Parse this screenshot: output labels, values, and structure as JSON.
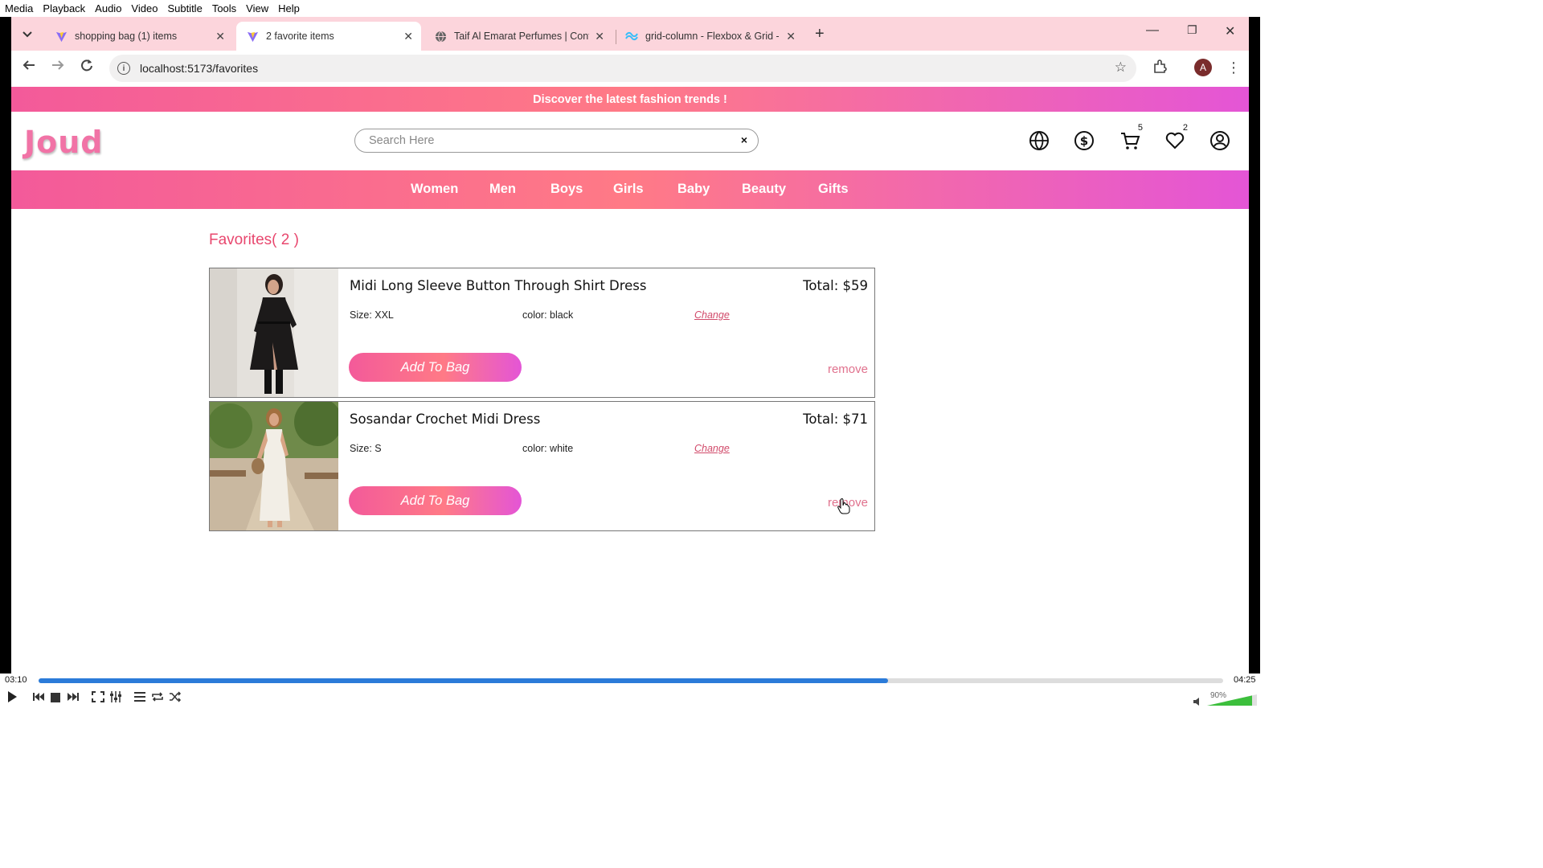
{
  "vlc": {
    "menu": [
      "Media",
      "Playback",
      "Audio",
      "Video",
      "Subtitle",
      "Tools",
      "View",
      "Help"
    ],
    "time_current": "03:10",
    "time_total": "04:25",
    "progress_fraction": 0.717,
    "volume": "90%"
  },
  "browser": {
    "tabs": [
      {
        "title": "shopping bag (1) items",
        "active": false
      },
      {
        "title": "2 favorite items",
        "active": true
      },
      {
        "title": "Taif Al Emarat Perfumes | Contir",
        "active": false
      },
      {
        "title": "grid-column - Flexbox & Grid -",
        "active": false
      }
    ],
    "url": "localhost:5173/favorites",
    "profile_initial": "A"
  },
  "site": {
    "promo": "Discover the latest fashion trends !",
    "logo": "Joud",
    "search_placeholder": "Search Here",
    "search_clear": "×",
    "cart_count": "5",
    "favorites_count": "2",
    "categories": [
      "Women",
      "Men",
      "Boys",
      "Girls",
      "Baby",
      "Beauty",
      "Gifts"
    ],
    "favorites_title": "Favorites( 2 )",
    "items": [
      {
        "name": "Midi Long Sleeve Button Through Shirt Dress",
        "total": "Total: $59",
        "size": "Size: XXL",
        "color": "color: black",
        "change": "Change",
        "add_label": "Add To Bag",
        "remove_label": "remove"
      },
      {
        "name": "Sosandar Crochet Midi Dress",
        "total": "Total: $71",
        "size": "Size: S",
        "color": "color: white",
        "change": "Change",
        "add_label": "Add To Bag",
        "remove_label": "remove"
      }
    ]
  },
  "colors": {
    "accent_pink": "#f35a9a",
    "accent_coral": "#ff7a86",
    "accent_magenta": "#e455d6",
    "tabstrip": "#fcd5dc",
    "title_red": "#e8476e"
  }
}
